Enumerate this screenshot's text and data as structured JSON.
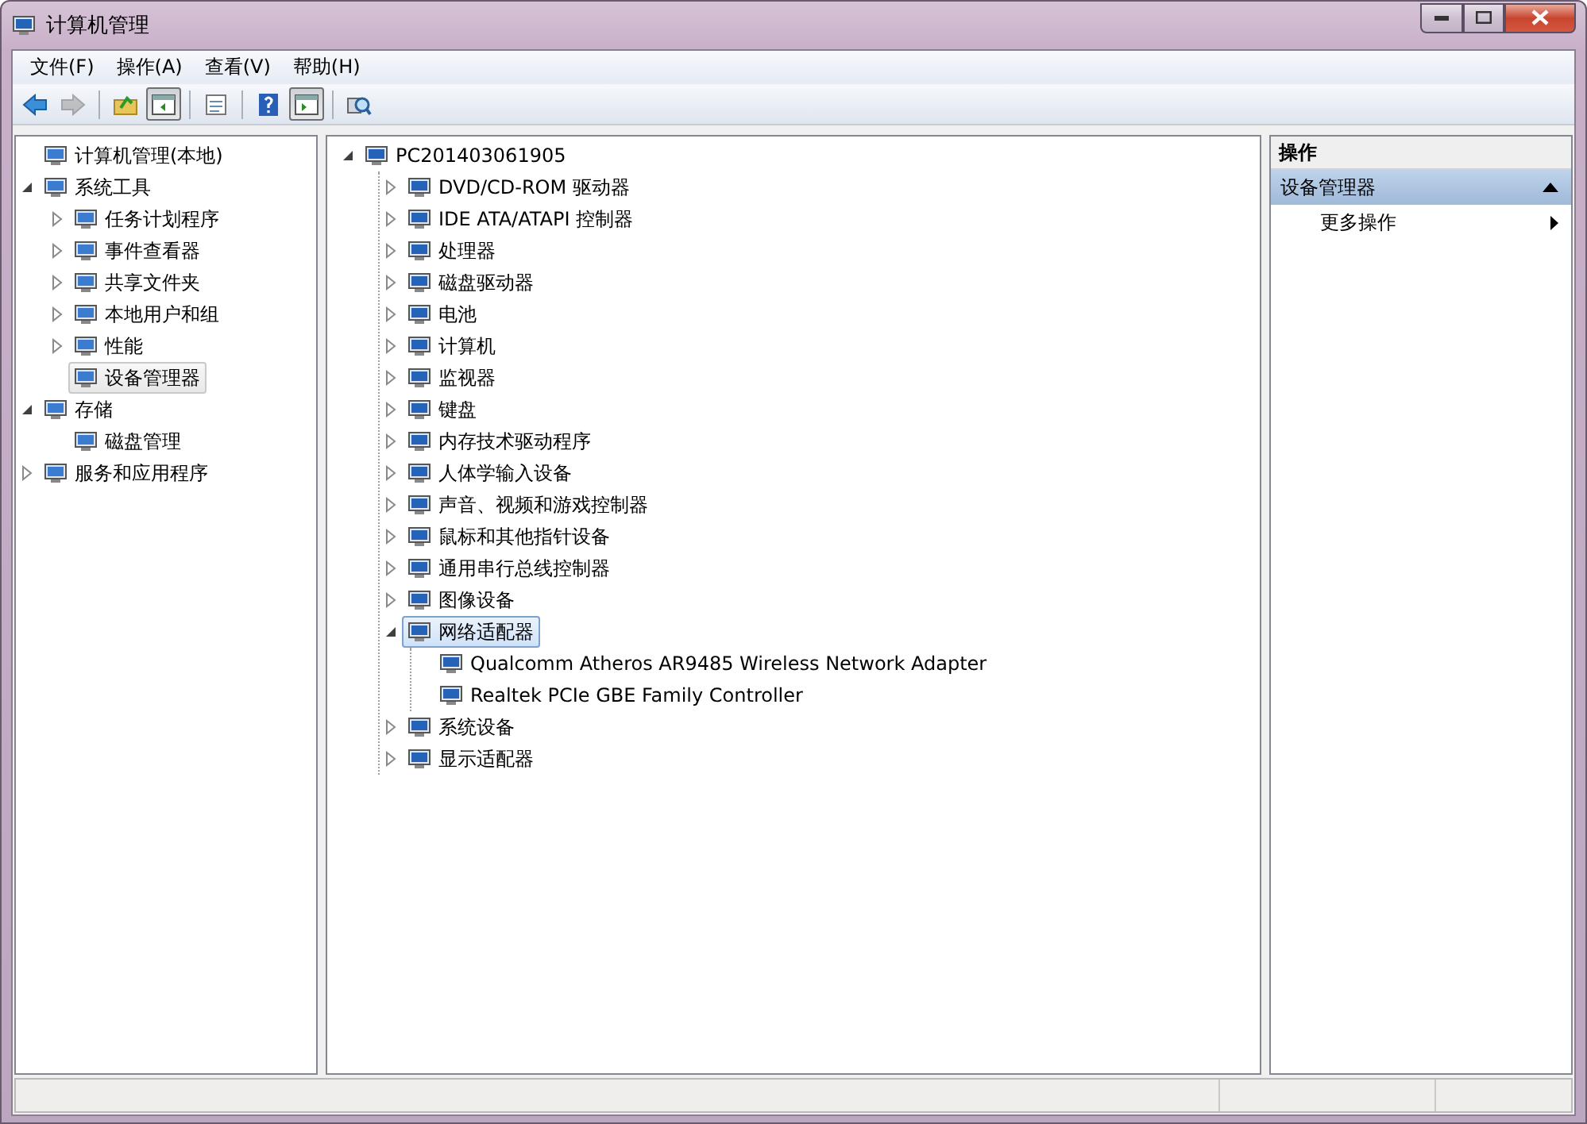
{
  "window": {
    "title": "计算机管理"
  },
  "menu": [
    {
      "label": "文件(F)"
    },
    {
      "label": "操作(A)"
    },
    {
      "label": "查看(V)"
    },
    {
      "label": "帮助(H)"
    }
  ],
  "toolbar": [
    {
      "kind": "back",
      "disabled": false,
      "pressed": false
    },
    {
      "kind": "forward",
      "disabled": true,
      "pressed": false
    },
    {
      "kind": "separator"
    },
    {
      "kind": "up",
      "disabled": false,
      "pressed": false
    },
    {
      "kind": "tree",
      "disabled": false,
      "pressed": true
    },
    {
      "kind": "separator"
    },
    {
      "kind": "properties",
      "disabled": false,
      "pressed": false
    },
    {
      "kind": "separator"
    },
    {
      "kind": "help",
      "disabled": false,
      "pressed": false
    },
    {
      "kind": "pane",
      "disabled": false,
      "pressed": true
    },
    {
      "kind": "separator"
    },
    {
      "kind": "scan",
      "disabled": false,
      "pressed": false
    }
  ],
  "console_tree": [
    {
      "label": "计算机管理(本地)",
      "selected": false,
      "children": [
        {
          "label": "系统工具",
          "expanded": true,
          "selected": false,
          "children": [
            {
              "label": "任务计划程序",
              "expanded": false,
              "selected": false
            },
            {
              "label": "事件查看器",
              "expanded": false,
              "selected": false
            },
            {
              "label": "共享文件夹",
              "expanded": false,
              "selected": false
            },
            {
              "label": "本地用户和组",
              "expanded": false,
              "selected": false
            },
            {
              "label": "性能",
              "expanded": false,
              "selected": false
            },
            {
              "label": "设备管理器",
              "selected": true
            }
          ]
        },
        {
          "label": "存储",
          "expanded": true,
          "selected": false,
          "children": [
            {
              "label": "磁盘管理",
              "selected": false
            }
          ]
        },
        {
          "label": "服务和应用程序",
          "expanded": false,
          "selected": false
        }
      ]
    }
  ],
  "device_tree": [
    {
      "label": "PC201403061905",
      "expanded": true,
      "selected": false,
      "children": [
        {
          "label": "DVD/CD-ROM 驱动器",
          "expanded": false,
          "selected": false
        },
        {
          "label": "IDE ATA/ATAPI 控制器",
          "expanded": false,
          "selected": false
        },
        {
          "label": "处理器",
          "expanded": false,
          "selected": false
        },
        {
          "label": "磁盘驱动器",
          "expanded": false,
          "selected": false
        },
        {
          "label": "电池",
          "expanded": false,
          "selected": false
        },
        {
          "label": "计算机",
          "expanded": false,
          "selected": false
        },
        {
          "label": "监视器",
          "expanded": false,
          "selected": false
        },
        {
          "label": "键盘",
          "expanded": false,
          "selected": false
        },
        {
          "label": "内存技术驱动程序",
          "expanded": false,
          "selected": false
        },
        {
          "label": "人体学输入设备",
          "expanded": false,
          "selected": false
        },
        {
          "label": "声音、视频和游戏控制器",
          "expanded": false,
          "selected": false
        },
        {
          "label": "鼠标和其他指针设备",
          "expanded": false,
          "selected": false
        },
        {
          "label": "通用串行总线控制器",
          "expanded": false,
          "selected": false
        },
        {
          "label": "图像设备",
          "expanded": false,
          "selected": false
        },
        {
          "label": "网络适配器",
          "expanded": true,
          "selected": true,
          "children": [
            {
              "label": "Qualcomm Atheros AR9485 Wireless Network Adapter",
              "selected": false
            },
            {
              "label": "Realtek PCIe GBE Family Controller",
              "selected": false
            }
          ]
        },
        {
          "label": "系统设备",
          "expanded": false,
          "selected": false
        },
        {
          "label": "显示适配器",
          "expanded": false,
          "selected": false
        }
      ]
    }
  ],
  "actions": {
    "title": "操作",
    "section": {
      "label": "设备管理器",
      "expanded": true
    },
    "items": [
      {
        "label": "更多操作"
      }
    ]
  }
}
